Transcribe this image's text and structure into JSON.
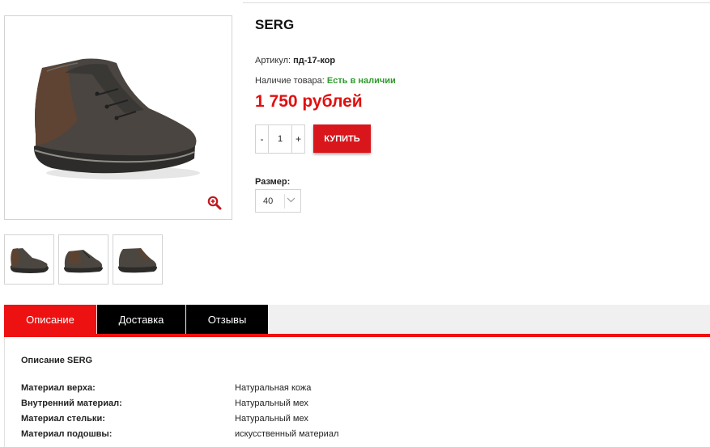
{
  "product": {
    "title": "SERG",
    "sku_label": "Артикул:",
    "sku_value": "пд-17-кор",
    "stock_label": "Наличие товара:",
    "stock_value": "Есть в наличии",
    "price": "1 750 рублей",
    "quantity": "1",
    "qty_minus": "-",
    "qty_plus": "+",
    "buy_label": "КУПИТЬ",
    "size_label": "Размер:",
    "size_value": "40"
  },
  "gallery": {
    "zoom_icon": "zoom-in-icon",
    "thumbnails": [
      "shoe-side-view",
      "shoe-pair-view",
      "shoe-side-view-2"
    ]
  },
  "tabs": [
    {
      "label": "Описание",
      "active": true
    },
    {
      "label": "Доставка",
      "active": false
    },
    {
      "label": "Отзывы",
      "active": false
    }
  ],
  "description": {
    "heading": "Описание SERG",
    "specs": [
      {
        "key": "Материал верха:",
        "value": "Натуральная кожа"
      },
      {
        "key": "Внутренний материал:",
        "value": "Натуральный мех"
      },
      {
        "key": "Материал стельки:",
        "value": "Натуральный мех"
      },
      {
        "key": "Материал подошвы:",
        "value": "искусственный материал"
      }
    ]
  },
  "colors": {
    "accent_red": "#ee1111",
    "buy_button": "#d9161c",
    "price": "#e01010",
    "in_stock": "#2f9b2f",
    "inactive_tab": "#000000"
  }
}
